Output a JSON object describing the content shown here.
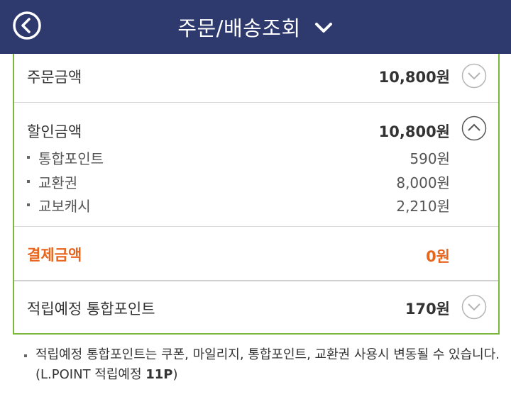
{
  "header": {
    "title": "주문/배송조회",
    "back_icon": "circle-chevron-left-icon",
    "dropdown_icon": "chevron-down-icon"
  },
  "summary": {
    "order_amount": {
      "label": "주문금액",
      "value": "10,800원",
      "toggle": "collapsed"
    },
    "discount_amount": {
      "label": "할인금액",
      "value": "10,800원",
      "toggle": "expanded",
      "items": [
        {
          "label": "통합포인트",
          "value": "590원"
        },
        {
          "label": "교환권",
          "value": "8,000원"
        },
        {
          "label": "교보캐시",
          "value": "2,210원"
        }
      ]
    },
    "payment_amount": {
      "label": "결제금액",
      "value": "0원"
    },
    "expected_points": {
      "label": "적립예정 통합포인트",
      "value": "170원",
      "toggle": "collapsed"
    }
  },
  "notice": {
    "text": "적립예정 통합포인트는 쿠폰, 마일리지, 통합포인트, 교환권 사용시 변동될 수 있습니다. (L.POINT 적립예정 ",
    "points": "11P",
    "close": ")"
  },
  "colors": {
    "header_bg": "#2e3a6e",
    "panel_border": "#7ab83d",
    "highlight": "#e8651e",
    "toggle_border": "#b5b5b5"
  }
}
